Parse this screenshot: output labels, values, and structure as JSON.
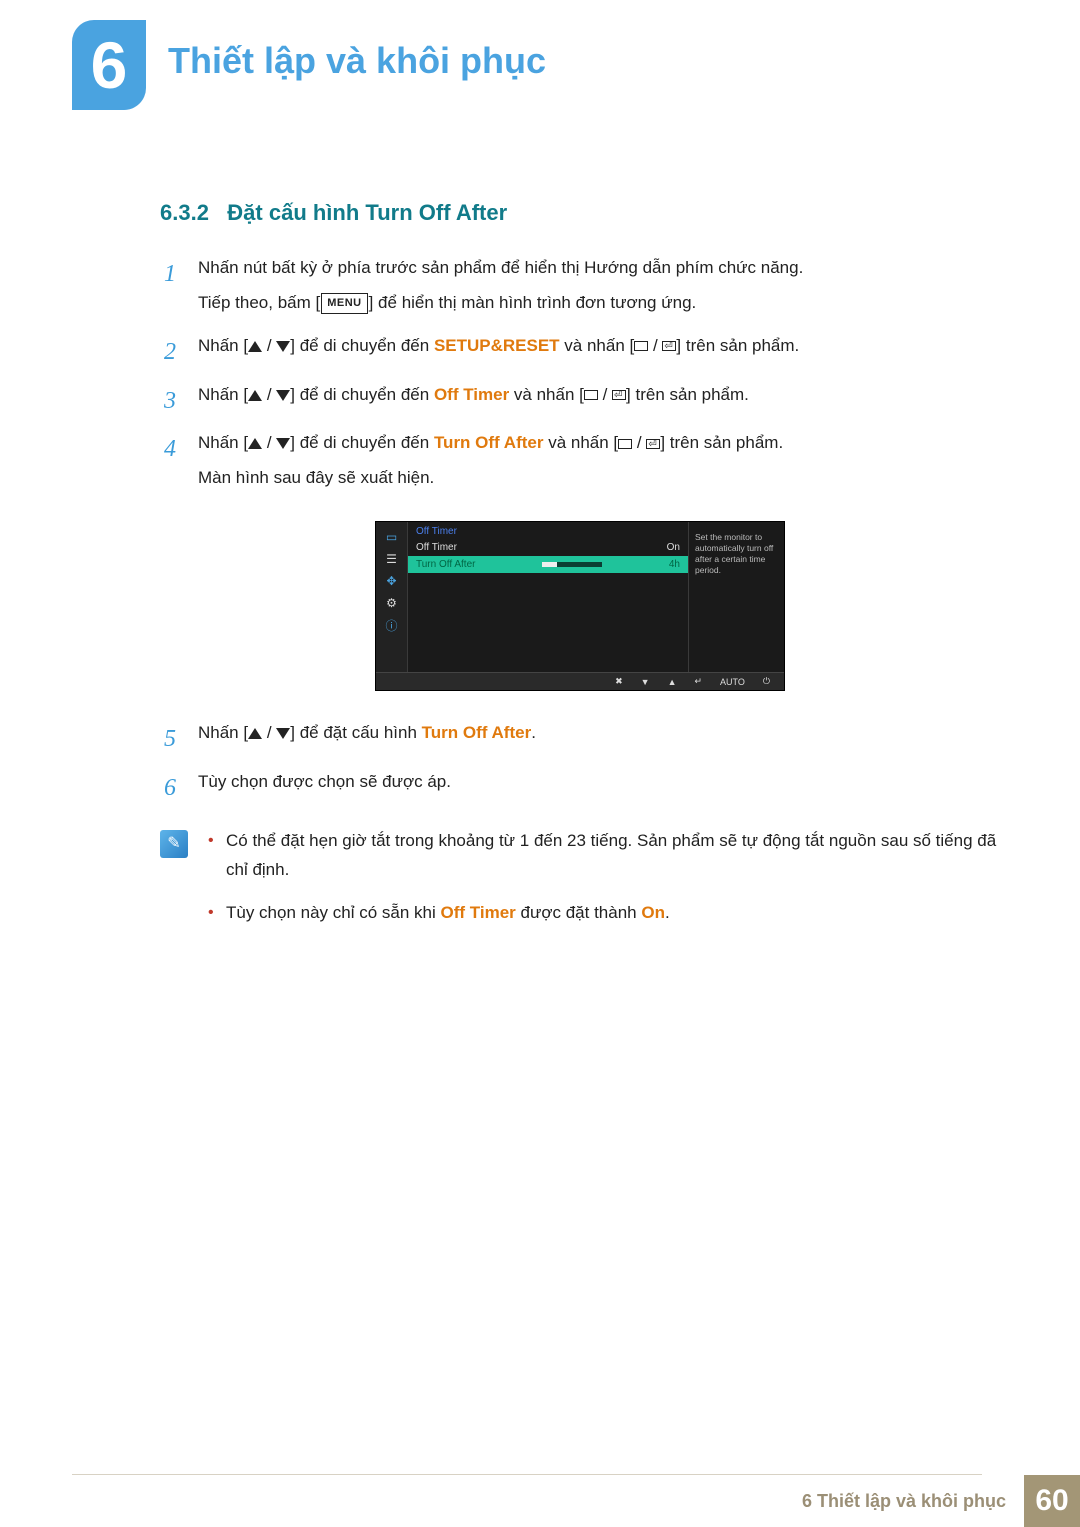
{
  "chapter": {
    "number": "6",
    "title": "Thiết lập và khôi phục"
  },
  "subsection": {
    "number": "6.3.2",
    "title": "Đặt cấu hình Turn Off After"
  },
  "steps": {
    "s1": {
      "num": "1",
      "line1_a": "Nhấn nút bất kỳ ở phía trước sản phẩm để hiển thị Hướng dẫn phím chức năng.",
      "line2_a": "Tiếp theo, bấm [",
      "menu": "MENU",
      "line2_b": "] để hiển thị màn hình trình đơn tương ứng."
    },
    "s2": {
      "num": "2",
      "a": "Nhấn [",
      "b": "] để di chuyển đến ",
      "target": "SETUP&RESET",
      "c": " và nhấn [",
      "d": "] trên sản phẩm."
    },
    "s3": {
      "num": "3",
      "a": "Nhấn [",
      "b": "] để di chuyển đến ",
      "target": "Off Timer",
      "c": " và nhấn [",
      "d": "] trên sản phẩm."
    },
    "s4": {
      "num": "4",
      "a": "Nhấn [",
      "b": "] để di chuyển đến ",
      "target": "Turn Off After",
      "c": " và nhấn [",
      "d": "] trên sản phẩm.",
      "tail": "Màn hình sau đây sẽ xuất hiện."
    },
    "s5": {
      "num": "5",
      "a": "Nhấn [",
      "b": "] để đặt cấu hình ",
      "target": "Turn Off After",
      "c": "."
    },
    "s6": {
      "num": "6",
      "text": "Tùy chọn được chọn sẽ được áp."
    }
  },
  "osd": {
    "title": "Off Timer",
    "rows": {
      "r1_label": "Off Timer",
      "r1_value": "On",
      "r2_label": "Turn Off After",
      "r2_value": "4h"
    },
    "help": "Set the monitor to automatically turn off after a certain time period.",
    "bottom": {
      "auto": "AUTO"
    }
  },
  "notes": {
    "n1": "Có thể đặt hẹn giờ tắt trong khoảng từ 1 đến 23 tiếng. Sản phẩm sẽ tự động tắt nguồn sau số tiếng đã chỉ định.",
    "n2_a": "Tùy chọn này chỉ có sẵn khi ",
    "n2_offtimer": "Off Timer",
    "n2_b": " được đặt thành ",
    "n2_on": "On",
    "n2_c": "."
  },
  "footer": {
    "text": "6 Thiết lập và khôi phục",
    "page": "60"
  }
}
